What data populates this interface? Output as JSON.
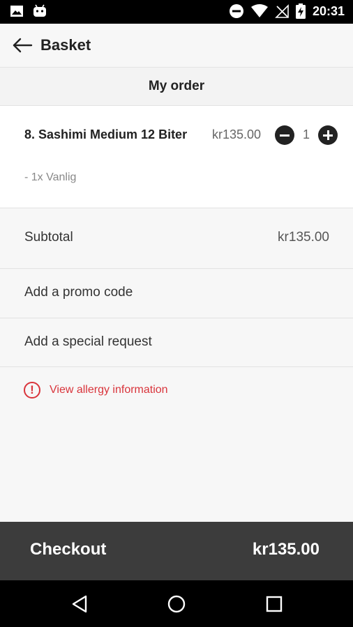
{
  "status_bar": {
    "time": "20:31",
    "icons": [
      "image-icon",
      "android-icon",
      "do-not-disturb-icon",
      "wifi-icon",
      "no-signal-icon",
      "battery-charging-icon"
    ]
  },
  "app_bar": {
    "title": "Basket",
    "back_icon": "arrow-left-icon"
  },
  "section": {
    "title": "My order"
  },
  "order": {
    "items": [
      {
        "name": "8. Sashimi Medium 12 Biter",
        "option": "- 1x Vanlig",
        "price": "kr135.00",
        "quantity": "1"
      }
    ]
  },
  "summary": {
    "subtotal_label": "Subtotal",
    "subtotal_value": "kr135.00",
    "promo_label": "Add a promo code",
    "special_label": "Add a special request"
  },
  "allergy": {
    "icon_glyph": "!",
    "label": "View allergy information",
    "color": "#d9343b"
  },
  "checkout": {
    "label": "Checkout",
    "total": "kr135.00",
    "background": "#3c3c3c"
  },
  "nav_bar": {
    "icons": [
      "back-triangle-icon",
      "home-circle-icon",
      "recents-square-icon"
    ]
  }
}
